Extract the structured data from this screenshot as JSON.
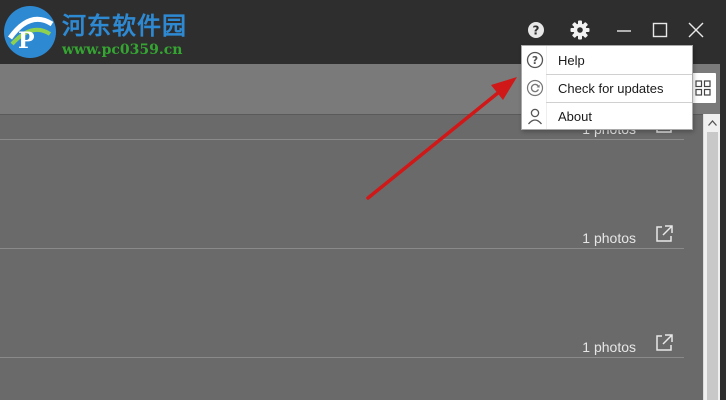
{
  "watermark": {
    "title": "河东软件园",
    "url": "www.pc0359.cn",
    "logo_icon": "pc-logo-icon"
  },
  "titlebar": {
    "help_icon": "help-circle-icon",
    "settings_icon": "gear-icon",
    "minimize_icon": "minimize-icon",
    "maximize_icon": "maximize-icon",
    "close_icon": "close-icon",
    "background": "#2e2e2e"
  },
  "toolbar": {
    "view_toggle_icon": "grid-view-icon"
  },
  "albums": [
    {
      "count": "1 photos"
    },
    {
      "count": "1 photos"
    },
    {
      "count": "1 photos"
    }
  ],
  "menu": {
    "items": [
      {
        "label": "Help",
        "icon": "help-circle-icon"
      },
      {
        "label": "Check for updates",
        "icon": "refresh-icon"
      },
      {
        "label": "About",
        "icon": "user-icon"
      }
    ]
  },
  "colors": {
    "content_bg": "#6a6a6a",
    "annotation_arrow": "#d01818",
    "watermark_blue": "#2e89d3",
    "watermark_green": "#35a532"
  }
}
